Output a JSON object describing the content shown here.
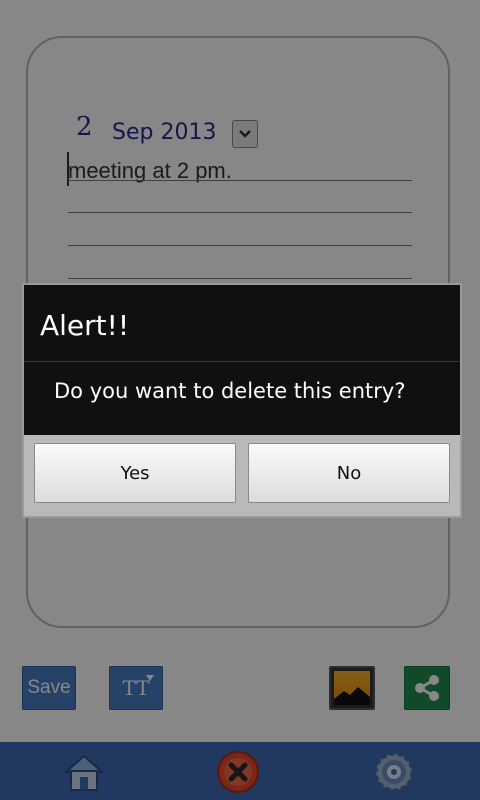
{
  "note": {
    "date_day": "2",
    "date_month_year": "Sep 2013",
    "text": "meeting at 2 pm."
  },
  "toolbar": {
    "save_label": "Save",
    "font_label": "TT"
  },
  "dialog": {
    "title": "Alert!!",
    "message": "Do you want to delete this entry?",
    "yes_label": "Yes",
    "no_label": "No"
  },
  "icons": {
    "dropdown": "chevron-down-icon",
    "font": "text-size-icon",
    "image": "image-icon",
    "share": "share-icon",
    "home": "home-icon",
    "delete": "delete-icon",
    "settings": "gear-icon"
  },
  "colors": {
    "navbar": "#3f6bb5",
    "button_blue": "#4a7ec4",
    "share_green": "#1f8c4e",
    "ink_blue": "#2b2b8c"
  }
}
